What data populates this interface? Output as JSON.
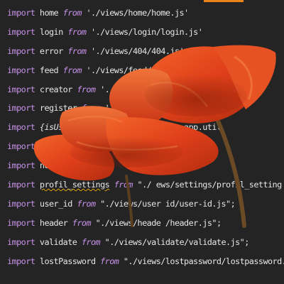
{
  "colors": {
    "background": "#242424",
    "keyword": "#c792ea",
    "text": "#e6e6e6",
    "accent": "#e8841a",
    "warning_underline": "#d9a400",
    "petal": "#e0401a",
    "stem": "#6b4a26"
  },
  "editor": {
    "lines": [
      {
        "kw": "import",
        "id": "home",
        "from": "from",
        "path": "'./views/home/home.js'",
        "end": ""
      },
      {
        "kw": "import",
        "id": "login",
        "from": "from",
        "path": "'./views/login/login.js'",
        "end": ""
      },
      {
        "kw": "import",
        "id": "error",
        "from": "from",
        "path": "'./views/404/404.js'",
        "end": ""
      },
      {
        "kw": "import",
        "id": "feed",
        "from": "from",
        "path": "'./views/feed/fe",
        "end": ""
      },
      {
        "kw": "import",
        "id": "creator",
        "from": "from",
        "path": "'./view",
        "end": ""
      },
      {
        "kw": "import",
        "id": "register",
        "from": "from",
        "path": "'./views/re",
        "end": ""
      },
      {
        "kw": "import",
        "id": "{isUser",
        "from": "",
        "path": "app.util",
        "end": ""
      },
      {
        "kw": "import",
        "id": "log",
        "from": "",
        "path": "",
        "end": ""
      },
      {
        "kw": "import",
        "id": "notify",
        "from": "",
        "path": "",
        "end": ""
      },
      {
        "kw": "import",
        "id": "profil_settings",
        "from": "from",
        "path": "\"./ ews/settings/profil_setting .js\"",
        "end": ";"
      },
      {
        "kw": "import",
        "id": "user_id",
        "from": "from",
        "path": "\"./views/user id/user-id.js\"",
        "end": ";"
      },
      {
        "kw": "import",
        "id": "header",
        "from": "from",
        "path": "\"./views/heade /header.js\"",
        "end": ";"
      },
      {
        "kw": "import",
        "id": "validate",
        "from": "from",
        "path": "\"./views/validate/validate.js\"",
        "end": ";"
      },
      {
        "kw": "import",
        "id": "lostPassword",
        "from": "from",
        "path": "\"./views/lostpassword/lostpassword.js\"",
        "end": ";"
      }
    ]
  },
  "overlay": {
    "icon": "poppy-flowers-icon"
  }
}
